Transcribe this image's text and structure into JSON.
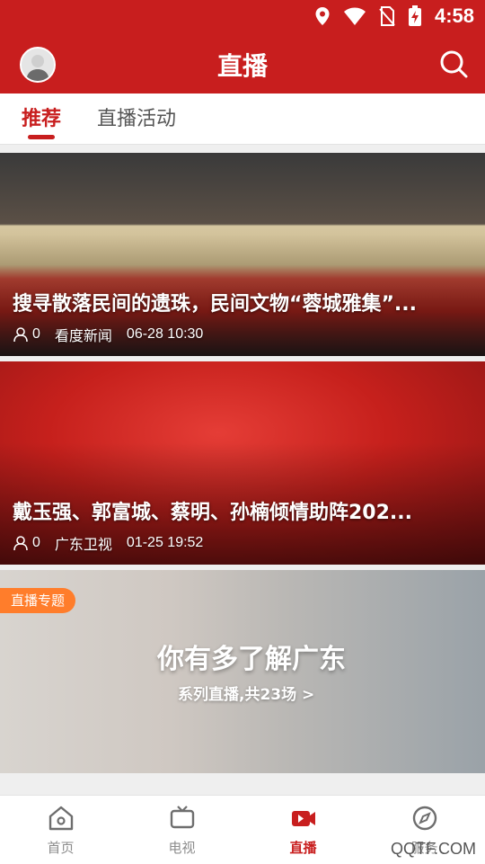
{
  "status": {
    "time": "4:58",
    "icons": [
      "location-icon",
      "wifi-icon",
      "no-sim-icon",
      "battery-charging-icon"
    ]
  },
  "header": {
    "title": "直播"
  },
  "tabs": [
    {
      "label": "推荐",
      "active": true
    },
    {
      "label": "直播活动",
      "active": false
    }
  ],
  "feed": [
    {
      "title": "搜寻散落民间的遗珠，民间文物“蓉城雅集”...",
      "viewers": "0",
      "source": "看度新闻",
      "time": "06-28 10:30"
    },
    {
      "title": "戴玉强、郭富城、蔡明、孙楠倾情助阵202...",
      "viewers": "0",
      "source": "广东卫视",
      "time": "01-25 19:52"
    }
  ],
  "special": {
    "badge": "直播专题",
    "title": "你有多了解广东",
    "subtitle": "系列直播,共23场 >"
  },
  "bottom_nav": [
    {
      "label": "首页"
    },
    {
      "label": "电视"
    },
    {
      "label": "直播"
    },
    {
      "label": "服务"
    }
  ],
  "watermark": "QQTF.COM",
  "colors": {
    "brand": "#c81e1e",
    "badge": "#ff7d2b"
  }
}
